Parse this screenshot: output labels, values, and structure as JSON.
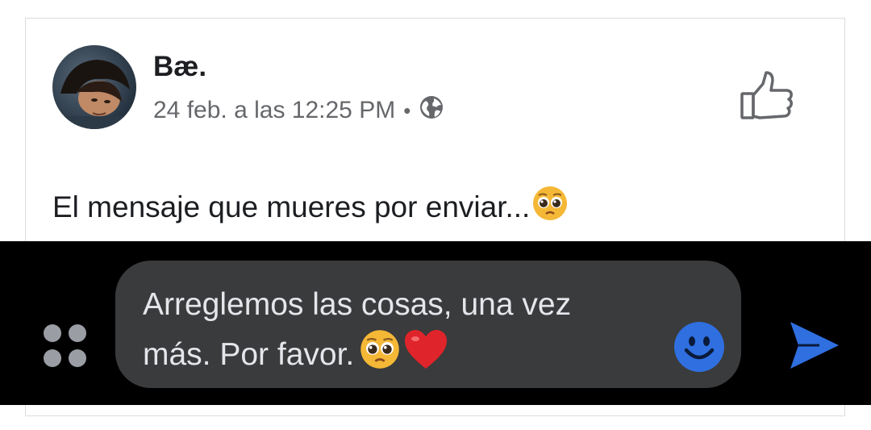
{
  "post": {
    "author": "Bæ.",
    "timestamp": "24 feb. a las 12:25 PM",
    "separator": "•",
    "privacy_icon": "globe-icon",
    "like_icon": "thumbs-up-icon",
    "text": "El mensaje que mueres por enviar...",
    "text_emoji": "pleading-face"
  },
  "composer": {
    "message_text": "Arreglemos las cosas, una vez más. Por favor.",
    "message_emojis": [
      "pleading-face",
      "red-heart"
    ],
    "apps_icon": "grid-dots-icon",
    "emoji_icon": "smiley-icon",
    "send_icon": "send-arrow-icon"
  },
  "colors": {
    "accent_blue": "#2f6fe0",
    "bubble_bg": "#3a3b3c",
    "overlay_bg": "#000000",
    "meta_gray": "#65676b"
  }
}
